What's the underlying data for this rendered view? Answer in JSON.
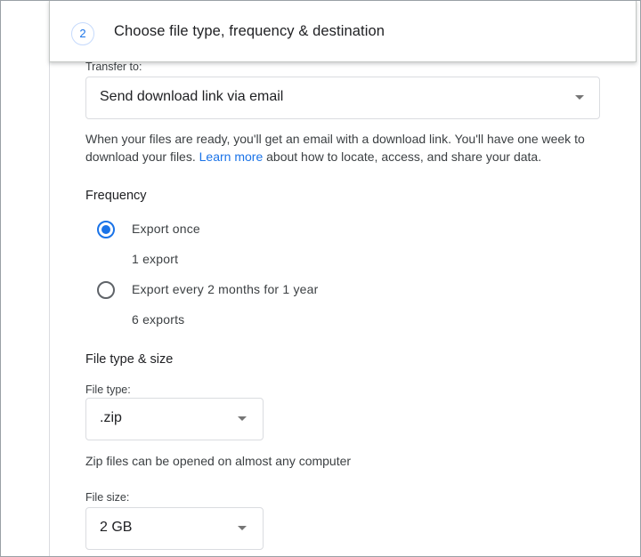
{
  "step": {
    "number": "2",
    "title": "Choose file type, frequency & destination"
  },
  "destination": {
    "label": "Transfer to:",
    "selected": "Send download link via email",
    "description_before": "When your files are ready, you'll get an email with a download link. You'll have one week to download your files. ",
    "link_text": "Learn more",
    "description_after": " about how to locate, access, and share your data."
  },
  "frequency": {
    "title": "Frequency",
    "options": [
      {
        "label": "Export once",
        "sublabel": "1 export",
        "checked": true
      },
      {
        "label": "Export every 2 months for 1 year",
        "sublabel": "6 exports",
        "checked": false
      }
    ]
  },
  "file_type_size": {
    "title": "File type & size",
    "file_type": {
      "label": "File type:",
      "selected": ".zip",
      "hint": "Zip files can be opened on almost any computer"
    },
    "file_size": {
      "label": "File size:",
      "selected": "2 GB"
    }
  },
  "colors": {
    "accent": "#1a73e8",
    "text": "#202124",
    "secondary_text": "#3c4043",
    "border": "#dadce0"
  },
  "icons": {
    "dropdown": "caret-down-icon"
  }
}
